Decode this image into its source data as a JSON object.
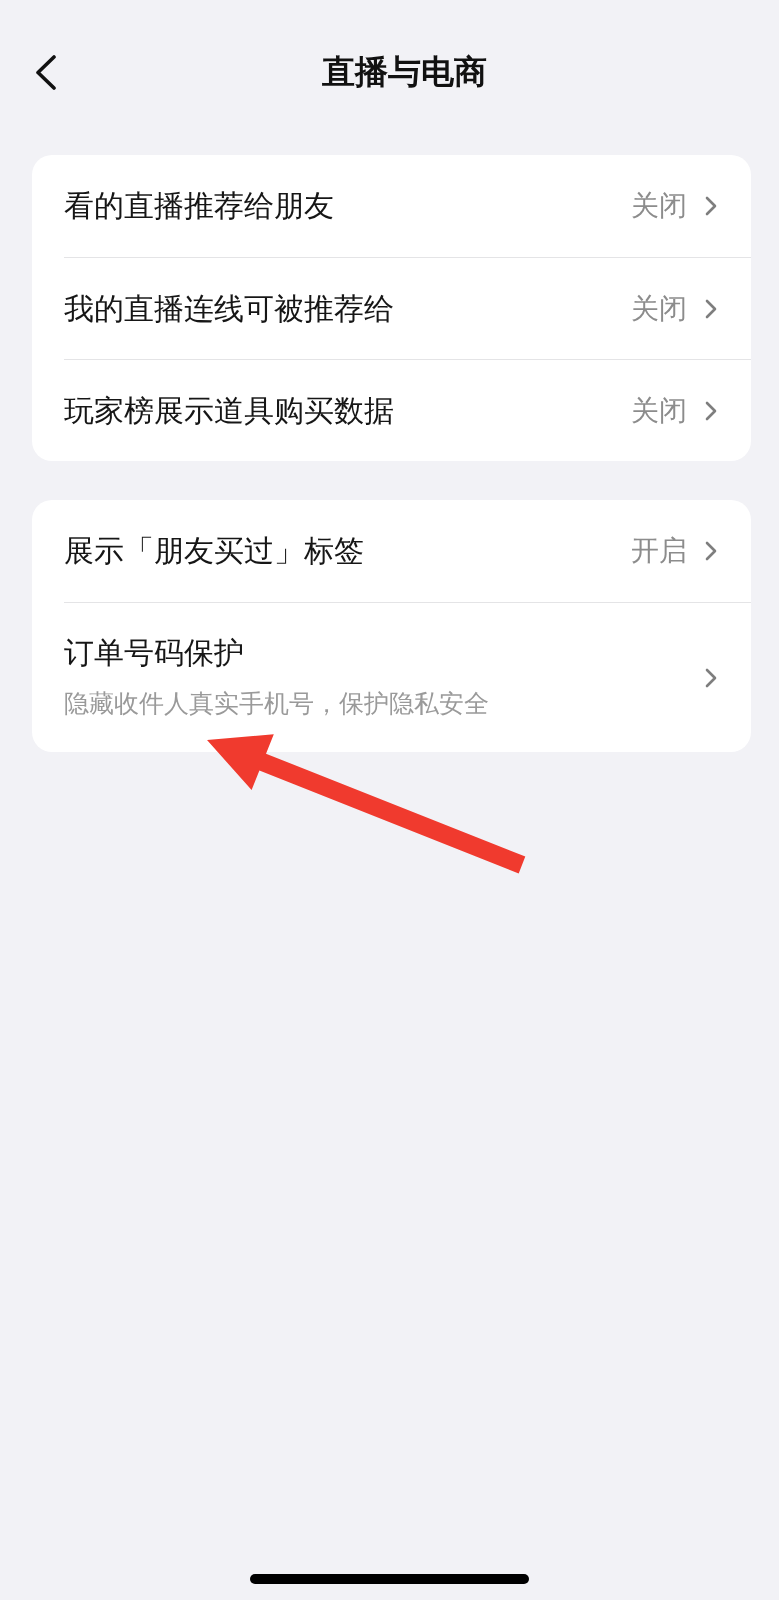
{
  "header": {
    "title": "直播与电商"
  },
  "groups": [
    {
      "items": [
        {
          "label": "看的直播推荐给朋友",
          "value": "关闭"
        },
        {
          "label": "我的直播连线可被推荐给",
          "value": "关闭"
        },
        {
          "label": "玩家榜展示道具购买数据",
          "value": "关闭"
        }
      ]
    },
    {
      "items": [
        {
          "label": "展示「朋友买过」标签",
          "value": "开启"
        },
        {
          "label": "订单号码保护",
          "description": "隐藏收件人真实手机号，保护隐私安全"
        }
      ]
    }
  ]
}
